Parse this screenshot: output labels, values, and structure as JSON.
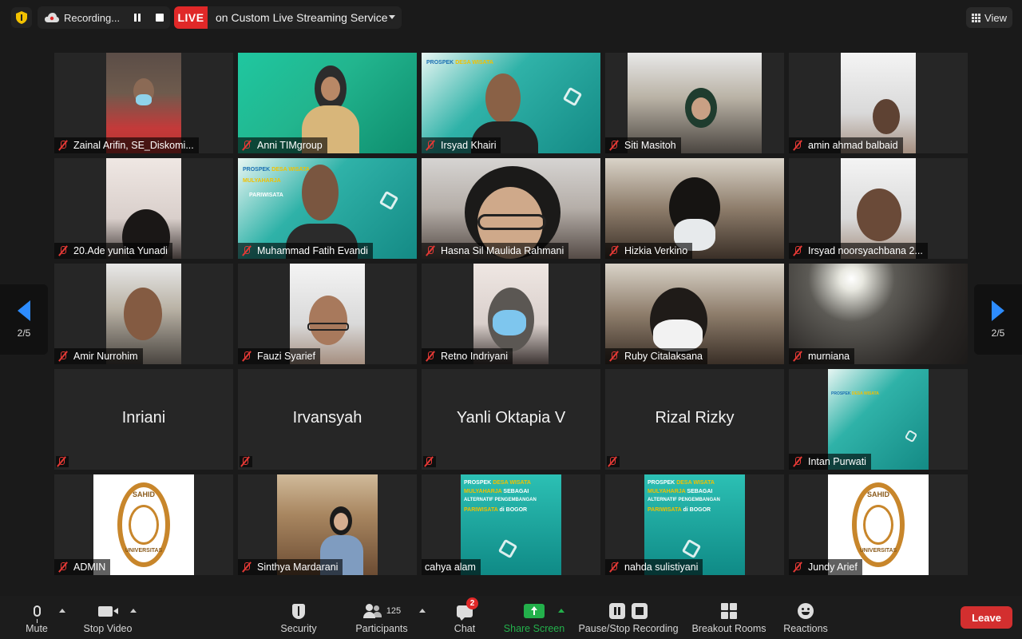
{
  "topbar": {
    "recording_label": "Recording...",
    "live_badge": "LIVE",
    "live_service": "on Custom Live Streaming Service",
    "view_label": "View"
  },
  "pagination": {
    "left": "2/5",
    "right": "2/5"
  },
  "participants": [
    {
      "name": "Zainal Arifin, SE_Diskomi...",
      "muted": true
    },
    {
      "name": "Anni TIMgroup",
      "muted": true
    },
    {
      "name": "Irsyad Khairi",
      "muted": true
    },
    {
      "name": "Siti Masitoh",
      "muted": true
    },
    {
      "name": "amin ahmad balbaid",
      "muted": true
    },
    {
      "name": "20.Ade yunita Yunadi",
      "muted": true
    },
    {
      "name": "Muhammad Fatih Evandi",
      "muted": true
    },
    {
      "name": "Hasna Sil Maulida Rahmani",
      "muted": true
    },
    {
      "name": "Hizkia Verkino",
      "muted": true
    },
    {
      "name": "Irsyad noorsyachbana 2...",
      "muted": true
    },
    {
      "name": "Amir Nurrohim",
      "muted": true
    },
    {
      "name": "Fauzi Syarief",
      "muted": true
    },
    {
      "name": "Retno Indriyani",
      "muted": true
    },
    {
      "name": "Ruby Citalaksana",
      "muted": true
    },
    {
      "name": "murniana",
      "muted": true
    },
    {
      "name": "Inriani",
      "muted": true,
      "video": false
    },
    {
      "name": "Irvansyah",
      "muted": true,
      "video": false
    },
    {
      "name": "Yanli Oktapia V",
      "muted": true,
      "video": false
    },
    {
      "name": "Rizal Rizky",
      "muted": true,
      "video": false
    },
    {
      "name": "Intan Purwati",
      "muted": true
    },
    {
      "name": "ADMIN",
      "muted": true
    },
    {
      "name": "Sinthya Mardarani",
      "muted": true
    },
    {
      "name": "cahya alam",
      "muted": false
    },
    {
      "name": "nahda sulistiyani",
      "muted": true
    },
    {
      "name": "Jundy Arief",
      "muted": true
    }
  ],
  "poster": {
    "line1a": "PROSPEK",
    "line1b": "DESA WISATA",
    "line2a": "MULYAHARJA",
    "line2b": "SEBAGAI",
    "line3": "ALTERNATIF PENGEMBANGAN",
    "line4a": "PARIWISATA",
    "line4b": "di BOGOR"
  },
  "sahid_logo": {
    "top": "SAHID",
    "bottom": "UNIVERSITAS"
  },
  "toolbar": {
    "mute": "Mute",
    "stop_video": "Stop Video",
    "security": "Security",
    "participants": "Participants",
    "participants_count": "125",
    "chat": "Chat",
    "chat_badge": "2",
    "share_screen": "Share Screen",
    "pause_stop_recording": "Pause/Stop Recording",
    "breakout_rooms": "Breakout Rooms",
    "reactions": "Reactions",
    "leave": "Leave"
  },
  "colors": {
    "accent": "#2d8cff",
    "live_red": "#e02828",
    "share_green": "#23b04b",
    "leave_red": "#d32f2f",
    "muted_red": "#e53935"
  }
}
